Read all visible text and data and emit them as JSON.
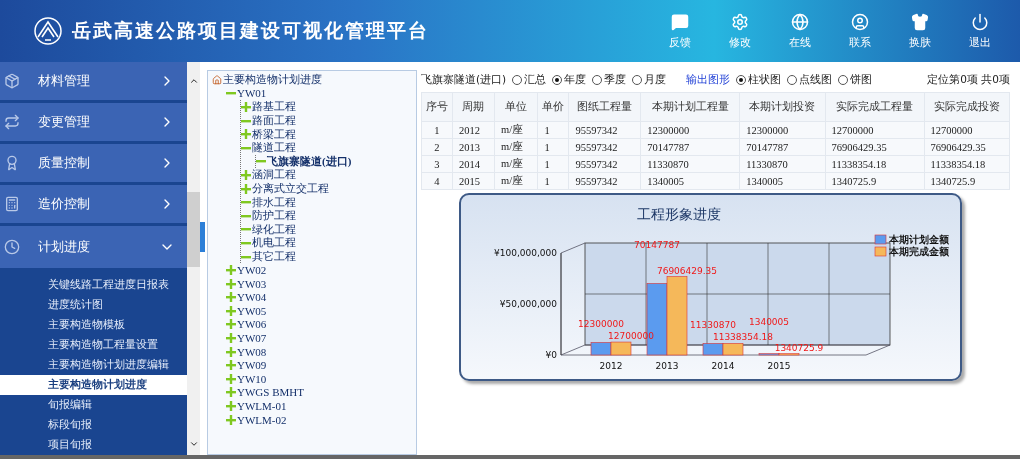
{
  "header": {
    "title": "岳武高速公路项目建设可视化管理平台",
    "actions": [
      {
        "kind": "feedback",
        "label": "反馈"
      },
      {
        "kind": "settings",
        "label": "修改"
      },
      {
        "kind": "online",
        "label": "在线"
      },
      {
        "kind": "contact",
        "label": "联系"
      },
      {
        "kind": "skin",
        "label": "换肤"
      },
      {
        "kind": "logout",
        "label": "退出"
      }
    ]
  },
  "sidebar": {
    "items": [
      {
        "kind": "material",
        "label": "材料管理",
        "expanded": false
      },
      {
        "kind": "change",
        "label": "变更管理",
        "expanded": false
      },
      {
        "kind": "quality",
        "label": "质量控制",
        "expanded": false
      },
      {
        "kind": "cost",
        "label": "造价控制",
        "expanded": false
      },
      {
        "kind": "plan",
        "label": "计划进度",
        "expanded": true,
        "children": [
          {
            "label": "关键线路工程进度日报表",
            "selected": false
          },
          {
            "label": "进度统计图",
            "selected": false
          },
          {
            "label": "主要构造物模板",
            "selected": false
          },
          {
            "label": "主要构造物工程量设置",
            "selected": false
          },
          {
            "label": "主要构造物计划进度编辑",
            "selected": false
          },
          {
            "label": "主要构造物计划进度",
            "selected": true
          },
          {
            "label": "旬报编辑",
            "selected": false
          },
          {
            "label": "标段旬报",
            "selected": false
          },
          {
            "label": "项目旬报",
            "selected": false
          }
        ]
      }
    ]
  },
  "tree": {
    "root": "主要构造物计划进度",
    "nodes": [
      {
        "label": "YW01",
        "expanded": true,
        "children": [
          {
            "label": "路基工程",
            "expanded": false
          },
          {
            "label": "路面工程",
            "expanded": true
          },
          {
            "label": "桥梁工程",
            "expanded": false
          },
          {
            "label": "隧道工程",
            "expanded": true,
            "children": [
              {
                "label": "飞旗寨隧道(进口)",
                "expanded": true,
                "selected": true
              }
            ]
          },
          {
            "label": "涵洞工程",
            "expanded": false
          },
          {
            "label": "分离式立交工程",
            "expanded": false
          },
          {
            "label": "排水工程",
            "expanded": true
          },
          {
            "label": "防护工程",
            "expanded": true
          },
          {
            "label": "绿化工程",
            "expanded": true
          },
          {
            "label": "机电工程",
            "expanded": true
          },
          {
            "label": "其它工程",
            "expanded": true
          }
        ]
      },
      {
        "label": "YW02",
        "expanded": false
      },
      {
        "label": "YW03",
        "expanded": false
      },
      {
        "label": "YW04",
        "expanded": false
      },
      {
        "label": "YW05",
        "expanded": false
      },
      {
        "label": "YW06",
        "expanded": false
      },
      {
        "label": "YW07",
        "expanded": false
      },
      {
        "label": "YW08",
        "expanded": false
      },
      {
        "label": "YW09",
        "expanded": false
      },
      {
        "label": "YW10",
        "expanded": false
      },
      {
        "label": "YWGS BMHT",
        "expanded": false
      },
      {
        "label": "YWLM-01",
        "expanded": false
      },
      {
        "label": "YWLM-02",
        "expanded": false
      }
    ]
  },
  "filter": {
    "location": "飞旗寨隧道(进口)",
    "periods": [
      {
        "label": "汇总",
        "selected": false
      },
      {
        "label": "年度",
        "selected": true
      },
      {
        "label": "季度",
        "selected": false
      },
      {
        "label": "月度",
        "selected": false
      }
    ],
    "output_label": "输出图形",
    "chart_types": [
      {
        "label": "柱状图",
        "selected": true
      },
      {
        "label": "点线图",
        "selected": false
      },
      {
        "label": "饼图",
        "selected": false
      }
    ],
    "position": "定位第0项 共0项"
  },
  "table": {
    "columns": [
      "序号",
      "周期",
      "单位",
      "单价",
      "图纸工程量",
      "本期计划工程量",
      "本期计划投资",
      "实际完成工程量",
      "实际完成投资"
    ],
    "rows": [
      [
        "1",
        "2012",
        "m/座",
        "1",
        "95597342",
        "12300000",
        "12300000",
        "12700000",
        "12700000"
      ],
      [
        "2",
        "2013",
        "m/座",
        "1",
        "95597342",
        "70147787",
        "70147787",
        "76906429.35",
        "76906429.35"
      ],
      [
        "3",
        "2014",
        "m/座",
        "1",
        "95597342",
        "11330870",
        "11330870",
        "11338354.18",
        "11338354.18"
      ],
      [
        "4",
        "2015",
        "m/座",
        "1",
        "95597342",
        "1340005",
        "1340005",
        "1340725.9",
        "1340725.9"
      ]
    ]
  },
  "chart": {
    "chart_data": {
      "type": "bar",
      "title": "工程形象进度",
      "legend": "right",
      "categories": [
        "2012",
        "2013",
        "2014",
        "2015"
      ],
      "series": [
        {
          "name": "本期计划金额",
          "color": "#5b9bef",
          "values": [
            12300000,
            70147787,
            11330870,
            1340005
          ]
        },
        {
          "name": "本期完成金额",
          "color": "#f5b85a",
          "values": [
            12700000,
            76906429.35,
            11338354.18,
            1340725.9
          ]
        }
      ],
      "ylim": [
        0,
        100000000
      ],
      "yticks": [
        {
          "value": 0,
          "label": "¥0"
        },
        {
          "value": 50000000,
          "label": "¥50,000,000"
        },
        {
          "value": 100000000,
          "label": "¥100,000,000"
        }
      ],
      "value_labels": [
        [
          "12300000",
          "70147787",
          "11330870",
          "1340005"
        ],
        [
          "12700000",
          "76906429.35",
          "11338354.18",
          "1340725.9"
        ]
      ]
    }
  }
}
